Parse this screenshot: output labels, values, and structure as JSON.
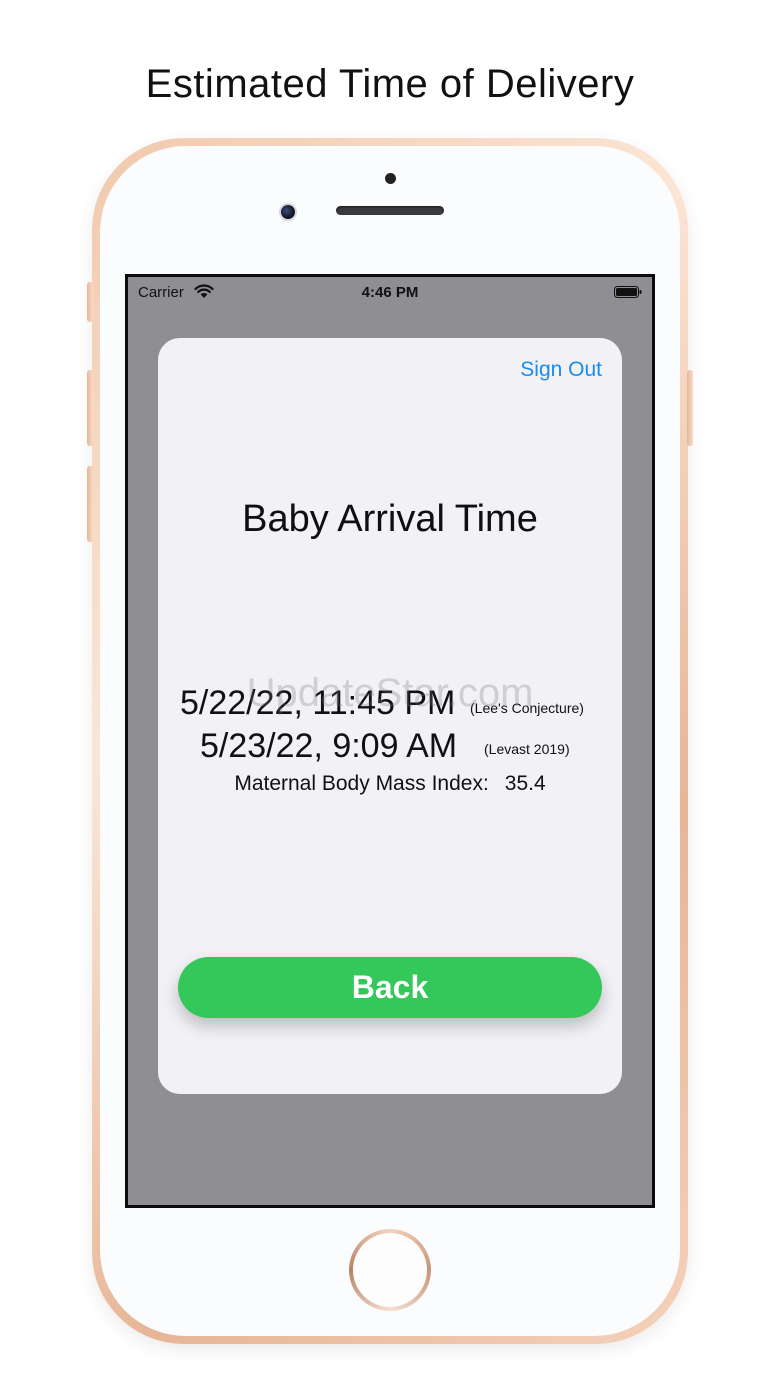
{
  "caption": "Estimated Time of Delivery",
  "status_bar": {
    "carrier": "Carrier",
    "time": "4:46 PM"
  },
  "card": {
    "sign_out_label": "Sign Out",
    "title": "Baby Arrival Time",
    "estimates": [
      {
        "datetime": "5/22/22, 11:45 PM",
        "source": "(Lee's Conjecture)"
      },
      {
        "datetime": "5/23/22, 9:09 AM",
        "source": "(Levast 2019)"
      }
    ],
    "bmi_label": "Maternal Body Mass Index:",
    "bmi_value": "35.4",
    "back_label": "Back"
  },
  "watermark": "UpdateStar.com",
  "colors": {
    "accent_blue": "#1a8cf0",
    "button_green": "#34c759",
    "screen_backdrop": "#8e8e93"
  }
}
